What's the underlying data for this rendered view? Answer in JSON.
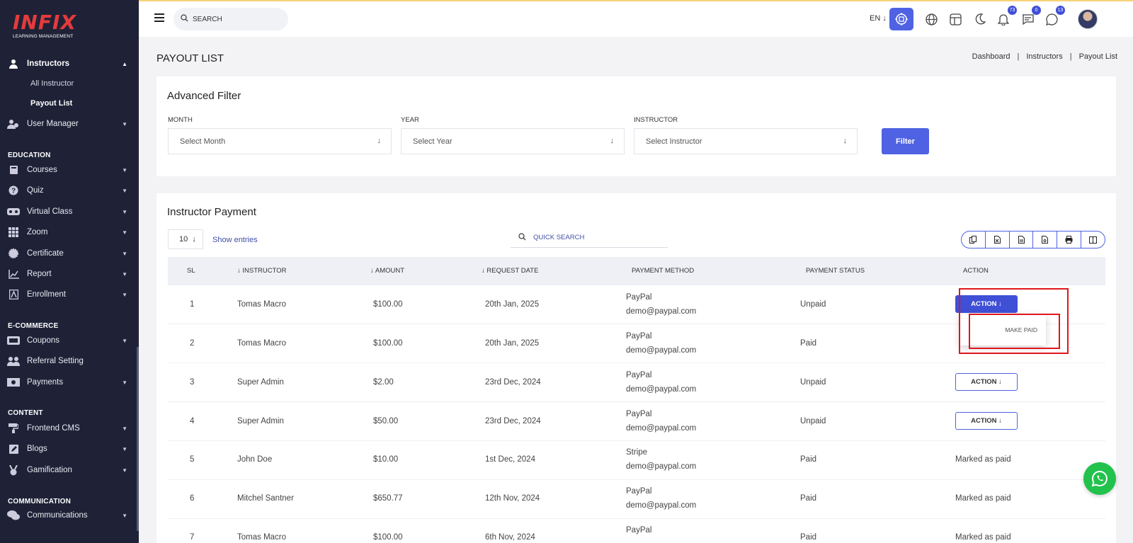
{
  "brand": {
    "logo_text": "INFIX",
    "logo_sub": "LEARNING MANAGEMENT"
  },
  "sidebar": {
    "items": [
      {
        "label": "Instructors",
        "icon": "user-icon"
      },
      {
        "label": "All Instructor"
      },
      {
        "label": "Payout List"
      },
      {
        "label": "User Manager",
        "icon": "users-icon"
      },
      {
        "section": "EDUCATION"
      },
      {
        "label": "Courses",
        "icon": "book-icon"
      },
      {
        "label": "Quiz",
        "icon": "question-icon"
      },
      {
        "label": "Virtual Class",
        "icon": "vr-icon"
      },
      {
        "label": "Zoom",
        "icon": "grid-icon"
      },
      {
        "label": "Certificate",
        "icon": "certificate-icon"
      },
      {
        "label": "Report",
        "icon": "chart-icon"
      },
      {
        "label": "Enrollment",
        "icon": "enrollment-icon"
      },
      {
        "section": "E-COMMERCE"
      },
      {
        "label": "Coupons",
        "icon": "coupon-icon"
      },
      {
        "label": "Referral Setting",
        "icon": "referral-icon"
      },
      {
        "label": "Payments",
        "icon": "money-icon"
      },
      {
        "section": "CONTENT"
      },
      {
        "label": "Frontend CMS",
        "icon": "paint-roller-icon"
      },
      {
        "label": "Blogs",
        "icon": "edit-icon"
      },
      {
        "label": "Gamification",
        "icon": "medal-icon"
      },
      {
        "section": "COMMUNICATION"
      },
      {
        "label": "Communications",
        "icon": "chat-icon"
      }
    ]
  },
  "header": {
    "search_placeholder": "SEARCH",
    "language": "EN",
    "notifications_count": "73",
    "messages_count": "0",
    "whatsapp_count": "13"
  },
  "page": {
    "title": "PAYOUT LIST",
    "breadcrumb": [
      "Dashboard",
      "Instructors",
      "Payout List"
    ]
  },
  "filter": {
    "title": "Advanced Filter",
    "month_label": "MONTH",
    "month_placeholder": "Select Month",
    "year_label": "YEAR",
    "year_placeholder": "Select Year",
    "instructor_label": "INSTRUCTOR",
    "instructor_placeholder": "Select Instructor",
    "button": "Filter"
  },
  "table": {
    "title": "Instructor Payment",
    "page_size": "10",
    "show_entries": "Show entries",
    "quick_search": "QUICK SEARCH",
    "columns": [
      "SL",
      "INSTRUCTOR",
      "AMOUNT",
      "REQUEST DATE",
      "PAYMENT METHOD",
      "PAYMENT STATUS",
      "ACTION"
    ],
    "rows": [
      {
        "sl": "1",
        "instructor": "Tomas Macro",
        "amount": "$100.00",
        "date": "20th Jan, 2025",
        "method": "PayPal",
        "account": "demo@paypal.com",
        "status": "Unpaid",
        "action": "ACTION"
      },
      {
        "sl": "2",
        "instructor": "Tomas Macro",
        "amount": "$100.00",
        "date": "20th Jan, 2025",
        "method": "PayPal",
        "account": "demo@paypal.com",
        "status": "Paid",
        "action": ""
      },
      {
        "sl": "3",
        "instructor": "Super Admin",
        "amount": "$2.00",
        "date": "23rd Dec, 2024",
        "method": "PayPal",
        "account": "demo@paypal.com",
        "status": "Unpaid",
        "action": "ACTION"
      },
      {
        "sl": "4",
        "instructor": "Super Admin",
        "amount": "$50.00",
        "date": "23rd Dec, 2024",
        "method": "PayPal",
        "account": "demo@paypal.com",
        "status": "Unpaid",
        "action": "ACTION"
      },
      {
        "sl": "5",
        "instructor": "John Doe",
        "amount": "$10.00",
        "date": "1st Dec, 2024",
        "method": "Stripe",
        "account": "demo@paypal.com",
        "status": "Paid",
        "action": "Marked as paid"
      },
      {
        "sl": "6",
        "instructor": "Mitchel Santner",
        "amount": "$650.77",
        "date": "12th Nov, 2024",
        "method": "PayPal",
        "account": "demo@paypal.com",
        "status": "Paid",
        "action": "Marked as paid"
      },
      {
        "sl": "7",
        "instructor": "Tomas Macro",
        "amount": "$100.00",
        "date": "6th Nov, 2024",
        "method": "PayPal",
        "account": "",
        "status": "Paid",
        "action": "Marked as paid"
      }
    ],
    "dropdown_item": "MAKE PAID"
  },
  "colors": {
    "sidebar_bg": "#1f2237",
    "primary": "#4f62e3",
    "highlight": "#e0161c",
    "whatsapp": "#22c24c"
  }
}
